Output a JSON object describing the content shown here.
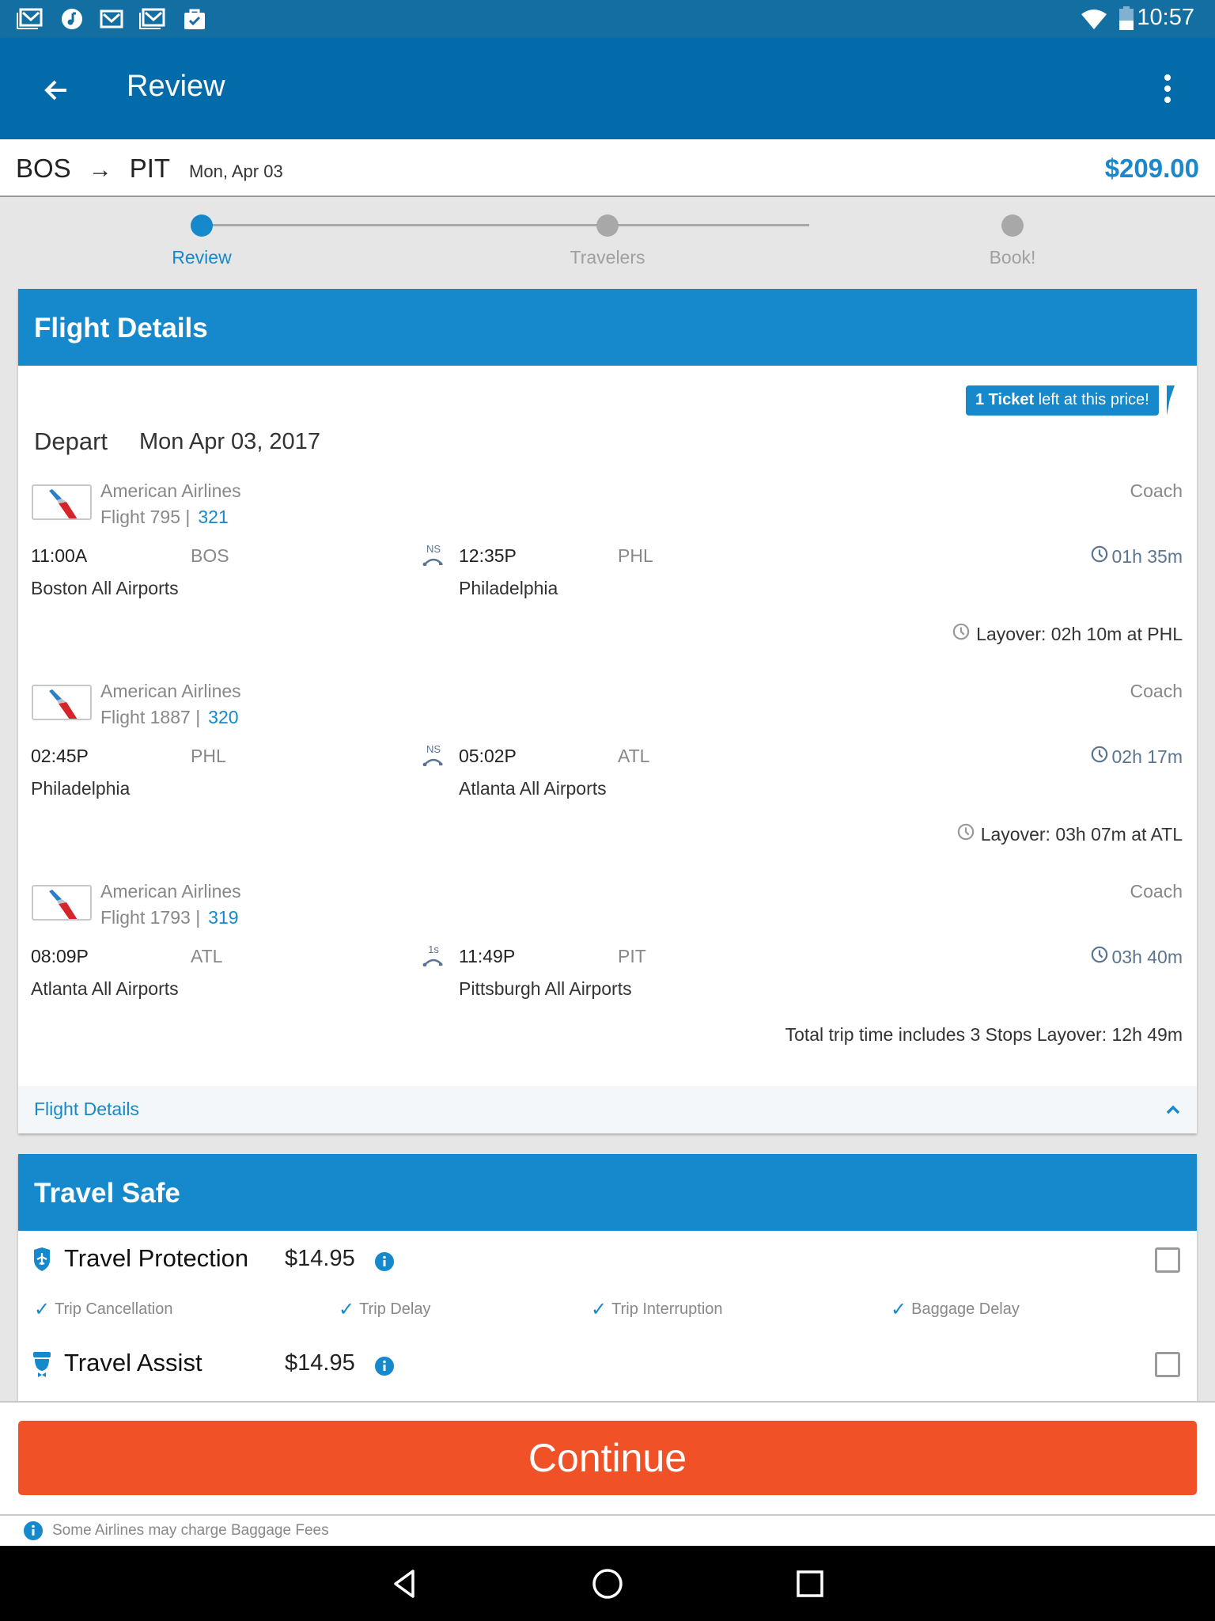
{
  "status_bar": {
    "time": "10:57",
    "left_icons": [
      "gmail-stack-icon",
      "music-icon",
      "gmail-icon",
      "gmail-stack-icon",
      "briefcase-check-icon"
    ],
    "right_icons": [
      "wifi-icon",
      "battery-icon"
    ]
  },
  "app_bar": {
    "title": "Review",
    "back_icon": "arrow-back-icon",
    "menu_icon": "more-vert-icon"
  },
  "route": {
    "origin": "BOS",
    "arrow": "→",
    "destination": "PIT",
    "date": "Mon, Apr 03",
    "price": "$209.00"
  },
  "stepper": {
    "steps": [
      {
        "label": "Review",
        "active": true
      },
      {
        "label": "Travelers",
        "active": false
      },
      {
        "label": "Book!",
        "active": false
      }
    ]
  },
  "flight_details": {
    "header": "Flight Details",
    "ticket_badge": {
      "bold": "1 Ticket",
      "rest": " left at this price!"
    },
    "depart_label": "Depart",
    "depart_date": "Mon Apr 03, 2017",
    "segments": [
      {
        "airline": "American Airlines",
        "flight": "Flight 795 |",
        "equipment": "321",
        "cabin": "Coach",
        "dep_time": "11:00A",
        "dep_code": "BOS",
        "dep_city": "Boston All Airports",
        "stop_label": "NS",
        "arr_time": "12:35P",
        "arr_code": "PHL",
        "arr_city": "Philadelphia",
        "duration": "01h 35m",
        "layover": "Layover: 02h 10m at PHL"
      },
      {
        "airline": "American Airlines",
        "flight": "Flight 1887 |",
        "equipment": "320",
        "cabin": "Coach",
        "dep_time": "02:45P",
        "dep_code": "PHL",
        "dep_city": "Philadelphia",
        "stop_label": "NS",
        "arr_time": "05:02P",
        "arr_code": "ATL",
        "arr_city": "Atlanta All Airports",
        "duration": "02h 17m",
        "layover": "Layover: 03h 07m at ATL"
      },
      {
        "airline": "American Airlines",
        "flight": "Flight 1793 |",
        "equipment": "319",
        "cabin": "Coach",
        "dep_time": "08:09P",
        "dep_code": "ATL",
        "dep_city": "Atlanta All Airports",
        "stop_label": "1s",
        "arr_time": "11:49P",
        "arr_code": "PIT",
        "arr_city": "Pittsburgh All Airports",
        "duration": "03h 40m"
      }
    ],
    "total_trip": "Total trip time includes 3 Stops Layover: 12h 49m",
    "footer_link": "Flight Details"
  },
  "travel_safe": {
    "header": "Travel Safe",
    "options": [
      {
        "title": "Travel Protection",
        "price": "$14.95",
        "icon": "shield-plane-icon",
        "checked": false,
        "benefits": [
          "Trip Cancellation",
          "Trip Delay",
          "Trip Interruption",
          "Baggage Delay"
        ]
      },
      {
        "title": "Travel Assist",
        "price": "$14.95",
        "icon": "concierge-icon",
        "checked": false
      }
    ]
  },
  "continue_label": "Continue",
  "footnote": "Some Airlines may charge Baggage Fees",
  "colors": {
    "primary": "#046bab",
    "accent": "#1589cc",
    "cta": "#f05127"
  }
}
